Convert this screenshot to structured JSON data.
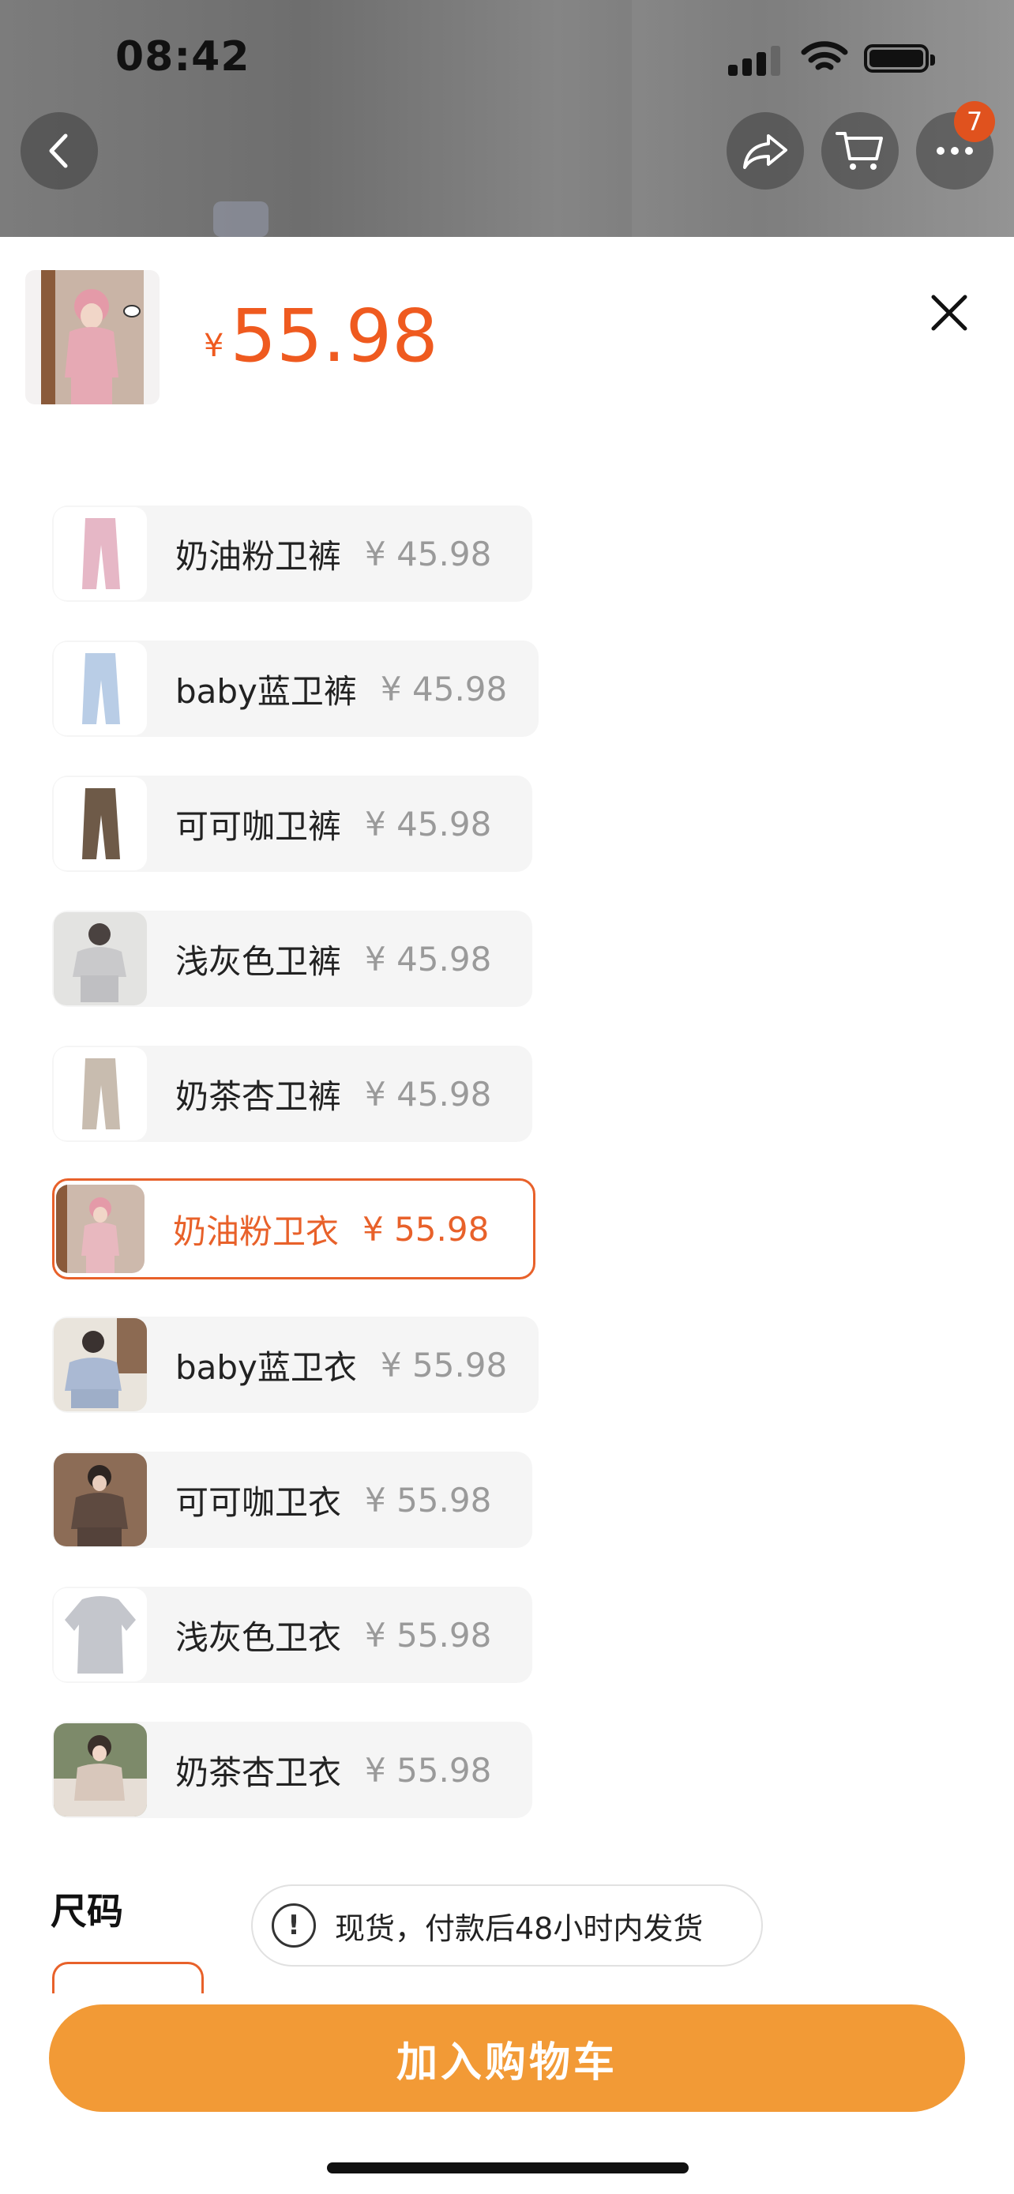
{
  "status_bar": {
    "time": "08:42"
  },
  "top_bar": {
    "cart_badge_count": "7"
  },
  "sheet": {
    "currency": "¥",
    "price": "55.98",
    "options": [
      {
        "name": "奶油粉卫裤",
        "price": "¥ 45.98",
        "selected": false,
        "thumb_color": "#e6b7c6"
      },
      {
        "name": "baby蓝卫裤",
        "price": "¥ 45.98",
        "selected": false,
        "thumb_color": "#b9cde6"
      },
      {
        "name": "可可咖卫裤",
        "price": "¥ 45.98",
        "selected": false,
        "thumb_color": "#6e5a48"
      },
      {
        "name": "浅灰色卫裤",
        "price": "¥ 45.98",
        "selected": false,
        "thumb_color": "#c9c9cb"
      },
      {
        "name": "奶茶杏卫裤",
        "price": "¥ 45.98",
        "selected": false,
        "thumb_color": "#c8bcaf"
      },
      {
        "name": "奶油粉卫衣",
        "price": "¥ 55.98",
        "selected": true,
        "thumb_color": "#e8b8bf"
      },
      {
        "name": "baby蓝卫衣",
        "price": "¥ 55.98",
        "selected": false,
        "thumb_color": "#aab9d3"
      },
      {
        "name": "可可咖卫衣",
        "price": "¥ 55.98",
        "selected": false,
        "thumb_color": "#5e4a40"
      },
      {
        "name": "浅灰色卫衣",
        "price": "¥ 55.98",
        "selected": false,
        "thumb_color": "#c4c6cc"
      },
      {
        "name": "奶茶杏卫衣",
        "price": "¥ 55.98",
        "selected": false,
        "thumb_color": "#d8c7bb"
      }
    ],
    "size_label": "尺码",
    "notice": "现货，付款后48小时内发货",
    "add_to_cart": "加入购物车"
  },
  "colors": {
    "accent": "#e8612a",
    "cta": "#f29a36"
  }
}
